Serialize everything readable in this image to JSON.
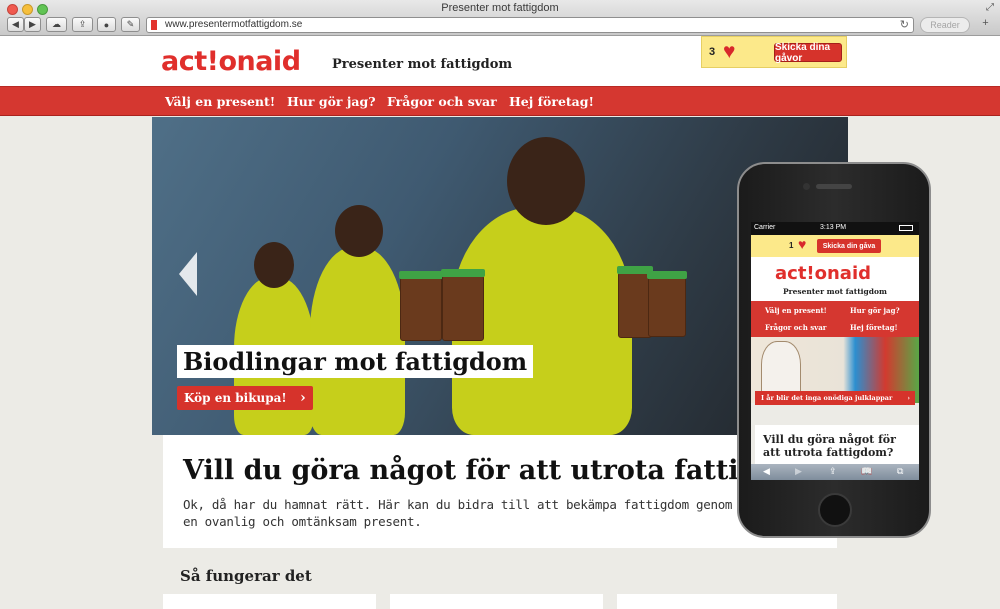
{
  "browser": {
    "title": "Presenter mot fattigdom",
    "url": "www.presentermotfattigdom.se",
    "reader_label": "Reader",
    "back_glyph": "◀",
    "forward_glyph": "▶",
    "reload_glyph": "↻",
    "plus_glyph": "+",
    "resize_glyph": "⤢"
  },
  "site": {
    "logo_text": "act!onaid",
    "tagline": "Presenter mot fattigdom",
    "cart": {
      "count": "3",
      "heart_glyph": "♥",
      "button_label": "Skicka dina gåvor"
    },
    "nav": [
      {
        "label": "Välj en present!"
      },
      {
        "label": "Hur gör jag?"
      },
      {
        "label": "Frågor och svar"
      },
      {
        "label": "Hej företag!"
      }
    ],
    "hero": {
      "caption": "Biodlingar mot fattigdom",
      "button_label": "Köp en bikupa!",
      "chevron_glyph": "›"
    },
    "content": {
      "heading": "Vill du göra något för att utrota fattigdom?",
      "intro": "Ok, då har du hamnat rätt. Här kan du bidra till att bekämpa fattigdom genom att ge bort en ovanlig och omtänksam present."
    },
    "how_heading": "Så fungerar det"
  },
  "phone": {
    "carrier": "Carrier",
    "time": "3:13 PM",
    "cart_count": "1",
    "cart_button": "Skicka din gåva",
    "logo_text": "act!onaid",
    "tagline": "Presenter mot fattigdom",
    "nav": [
      {
        "label": "Välj en present!"
      },
      {
        "label": "Hur gör jag?"
      },
      {
        "label": "Frågor och svar"
      },
      {
        "label": "Hej företag!"
      }
    ],
    "hero_button": "I år blir det inga onödiga julklappar",
    "hero_chevron": "›",
    "content_heading": "Vill du göra något för att utrota fattigdom?",
    "toolbar": {
      "back": "◀",
      "forward": "▶",
      "share": "⇪",
      "bookmarks": "📖",
      "tabs": "⧉"
    }
  },
  "colors": {
    "brand_red": "#d53730",
    "cart_yellow": "#fce98a",
    "hero_shirt": "#c6cf1b"
  }
}
